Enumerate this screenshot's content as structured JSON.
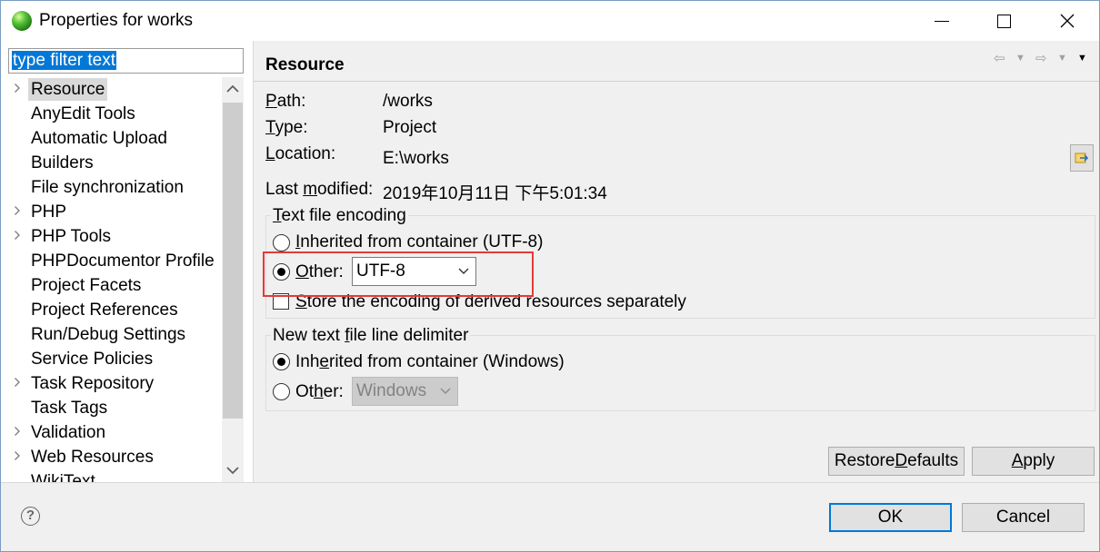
{
  "window": {
    "title": "Properties for works",
    "icon": "eclipse-globe-icon"
  },
  "filter": {
    "value": "type filter text"
  },
  "tree": {
    "items": [
      {
        "label": "Resource",
        "expandable": true,
        "selected": true
      },
      {
        "label": "AnyEdit Tools",
        "expandable": false
      },
      {
        "label": "Automatic Upload",
        "expandable": false
      },
      {
        "label": "Builders",
        "expandable": false
      },
      {
        "label": "File synchronization",
        "expandable": false
      },
      {
        "label": "PHP",
        "expandable": true
      },
      {
        "label": "PHP Tools",
        "expandable": true
      },
      {
        "label": "PHPDocumentor Profile",
        "expandable": false
      },
      {
        "label": "Project Facets",
        "expandable": false
      },
      {
        "label": "Project References",
        "expandable": false
      },
      {
        "label": "Run/Debug Settings",
        "expandable": false
      },
      {
        "label": "Service Policies",
        "expandable": false
      },
      {
        "label": "Task Repository",
        "expandable": true
      },
      {
        "label": "Task Tags",
        "expandable": false
      },
      {
        "label": "Validation",
        "expandable": true
      },
      {
        "label": "Web Resources",
        "expandable": true
      },
      {
        "label": "WikiText",
        "expandable": false
      }
    ]
  },
  "page": {
    "title": "Resource",
    "props": {
      "path_label_u": "P",
      "path_label_rest": "ath:",
      "path_value": "/works",
      "type_label_u": "T",
      "type_label_rest": "ype:",
      "type_value": "Project",
      "location_label_u": "L",
      "location_label_rest": "ocation:",
      "location_value": "E:\\works",
      "modified_label_a": "Last ",
      "modified_label_u": "m",
      "modified_label_b": "odified:",
      "modified_value": "2019年10月11日 下午5:01:34"
    },
    "encoding": {
      "group_title_u": "T",
      "group_title_rest": "ext file encoding",
      "inherited_u": "I",
      "inherited_rest": "nherited from container (UTF-8)",
      "other_u": "O",
      "other_rest": "ther:",
      "other_value": "UTF-8",
      "store_u": "S",
      "store_rest": "tore the encoding of derived resources separately",
      "selected": "other",
      "store_checked": false
    },
    "delimiter": {
      "group_title_a": "New text ",
      "group_title_u": "f",
      "group_title_b": "ile line delimiter",
      "inherited_a": "Inh",
      "inherited_u": "e",
      "inherited_b": "rited from container (Windows)",
      "other_a": "Ot",
      "other_u": "h",
      "other_b": "er:",
      "other_value": "Windows",
      "selected": "inherited"
    },
    "buttons": {
      "restore_a": "Restore ",
      "restore_u": "D",
      "restore_b": "efaults",
      "apply_u": "A",
      "apply_rest": "pply"
    }
  },
  "footer": {
    "ok": "OK",
    "cancel": "Cancel",
    "help_glyph": "?"
  },
  "colors": {
    "accent": "#0078d7",
    "highlight_box": "#e53935"
  }
}
